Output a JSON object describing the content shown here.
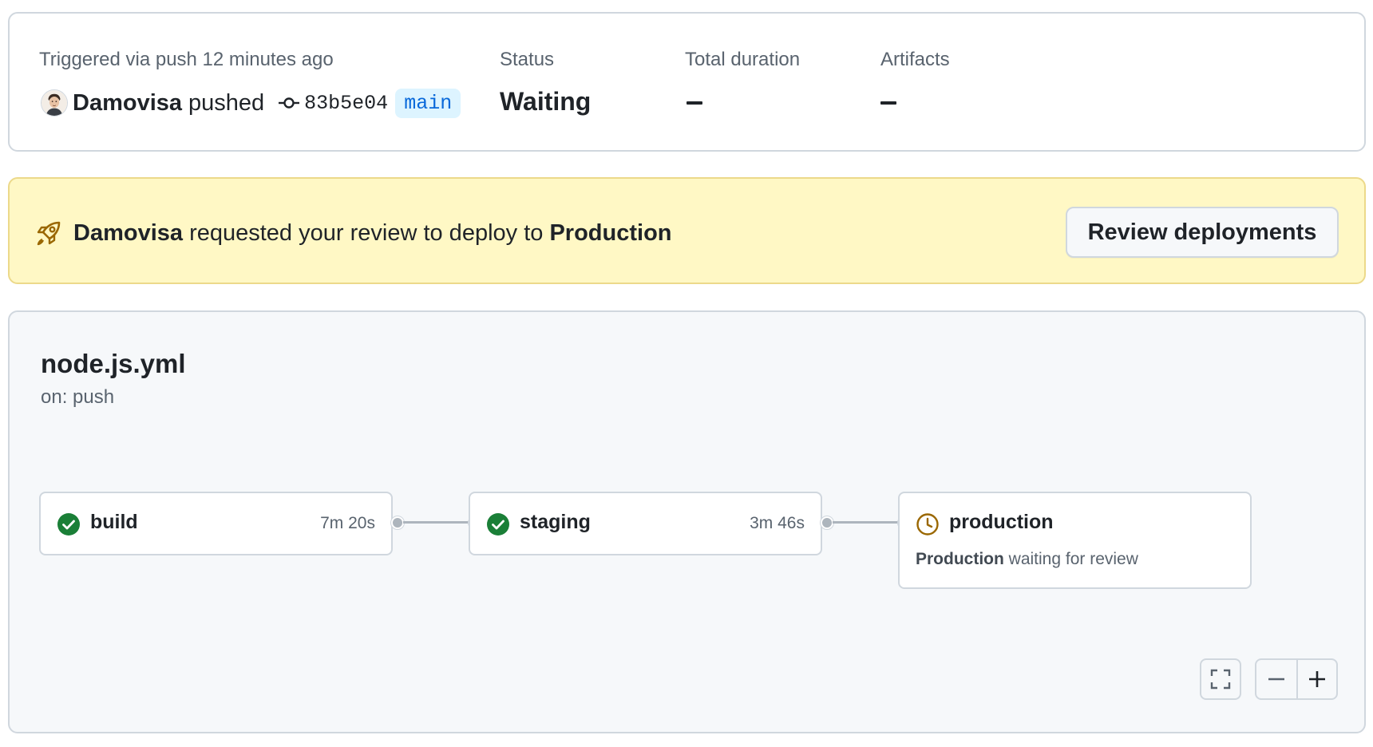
{
  "summary": {
    "trigger_label": "Triggered via push 12 minutes ago",
    "actor": "Damovisa",
    "action": "pushed",
    "commit_sha": "83b5e04",
    "branch": "main",
    "status_label": "Status",
    "status_value": "Waiting",
    "duration_label": "Total duration",
    "artifacts_label": "Artifacts"
  },
  "banner": {
    "actor": "Damovisa",
    "message": " requested your review to deploy to ",
    "environment": "Production",
    "button_label": "Review deployments",
    "icon": "rocket-icon"
  },
  "workflow": {
    "title": "node.js.yml",
    "trigger": "on: push",
    "jobs": [
      {
        "name": "build",
        "duration": "7m 20s",
        "status": "success"
      },
      {
        "name": "staging",
        "duration": "3m 46s",
        "status": "success"
      },
      {
        "name": "production",
        "status": "waiting",
        "note_env": "Production",
        "note_text": " waiting for review"
      }
    ]
  },
  "colors": {
    "success": "#1a7f37",
    "waiting": "#9a6700",
    "link": "#0969da",
    "banner_bg": "#fff8c5"
  }
}
